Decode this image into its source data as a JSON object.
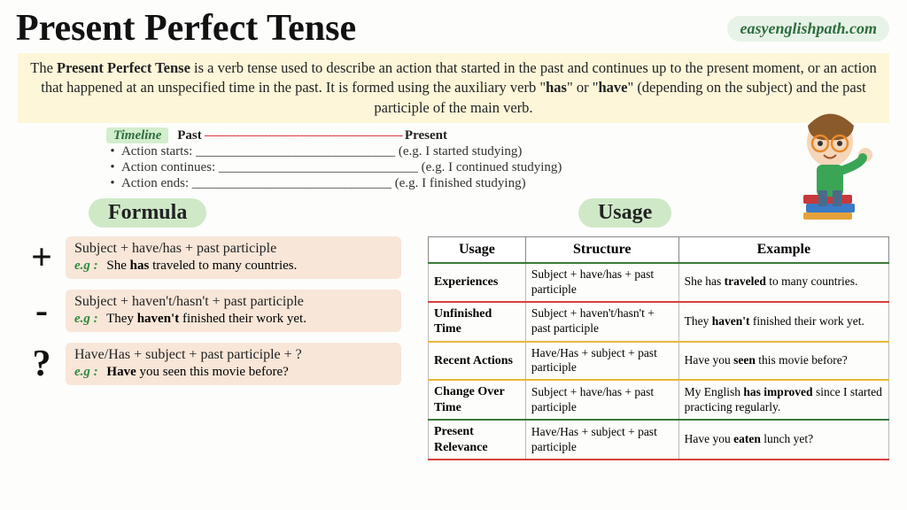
{
  "title": "Present Perfect Tense",
  "watermark": "easyenglishpath.com",
  "intro": {
    "prefix": "The ",
    "bold1": "Present Perfect Tense",
    "mid1": " is a verb tense used to describe an action that started in the past and continues up to the present moment, or an action that happened at an unspecified time in the past. It is formed using the auxiliary verb \"",
    "bold2": "has",
    "mid2": "\" or \"",
    "bold3": "have",
    "mid3": "\" (depending on the subject) and the past participle of the main verb."
  },
  "timeline": {
    "label": "Timeline",
    "past": "Past",
    "dashes": " -------------------------------------------------------- ",
    "present": "Present",
    "items": [
      {
        "label": "Action starts: ______________________________",
        "eg": " (e.g. I started studying)"
      },
      {
        "label": "Action continues: ______________________________",
        "eg": " (e.g. I continued studying)"
      },
      {
        "label": "Action ends: ______________________________",
        "eg": " (e.g. I finished studying)"
      }
    ]
  },
  "formula": {
    "heading": "Formula",
    "items": [
      {
        "sign": "+",
        "line": "Subject + have/has + past participle",
        "eg_pre": "She ",
        "eg_bold": "has",
        "eg_post": " traveled to many countries."
      },
      {
        "sign": "-",
        "line": "Subject + haven't/hasn't + past participle",
        "eg_pre": "They ",
        "eg_bold": "haven't",
        "eg_post": " finished their work yet."
      },
      {
        "sign": "?",
        "line": "Have/Has + subject + past participle + ?",
        "eg_pre": "",
        "eg_bold": "Have",
        "eg_post": " you seen this movie before?"
      }
    ],
    "eg_label": "e.g :"
  },
  "usage": {
    "heading": "Usage",
    "headers": [
      "Usage",
      "Structure",
      "Example"
    ],
    "rows": [
      {
        "name": "Experiences",
        "structure": "Subject + have/has + past participle",
        "ex_pre": "She has ",
        "ex_bold": "traveled",
        "ex_post": " to many countries."
      },
      {
        "name": "Unfinished Time",
        "structure": "Subject + haven't/hasn't + past participle",
        "ex_pre": "They ",
        "ex_bold": "haven't",
        "ex_post": " finished their work yet."
      },
      {
        "name": "Recent Actions",
        "structure": "Have/Has + subject + past participle",
        "ex_pre": "Have you ",
        "ex_bold": "seen",
        "ex_post": " this movie before?"
      },
      {
        "name": "Change Over Time",
        "structure": "Subject + have/has + past participle",
        "ex_pre": "My English ",
        "ex_bold": "has improved",
        "ex_post": " since I started practicing regularly."
      },
      {
        "name": "Present Relevance",
        "structure": "Have/Has + subject + past participle",
        "ex_pre": "Have you ",
        "ex_bold": "eaten",
        "ex_post": " lunch yet?"
      }
    ]
  }
}
